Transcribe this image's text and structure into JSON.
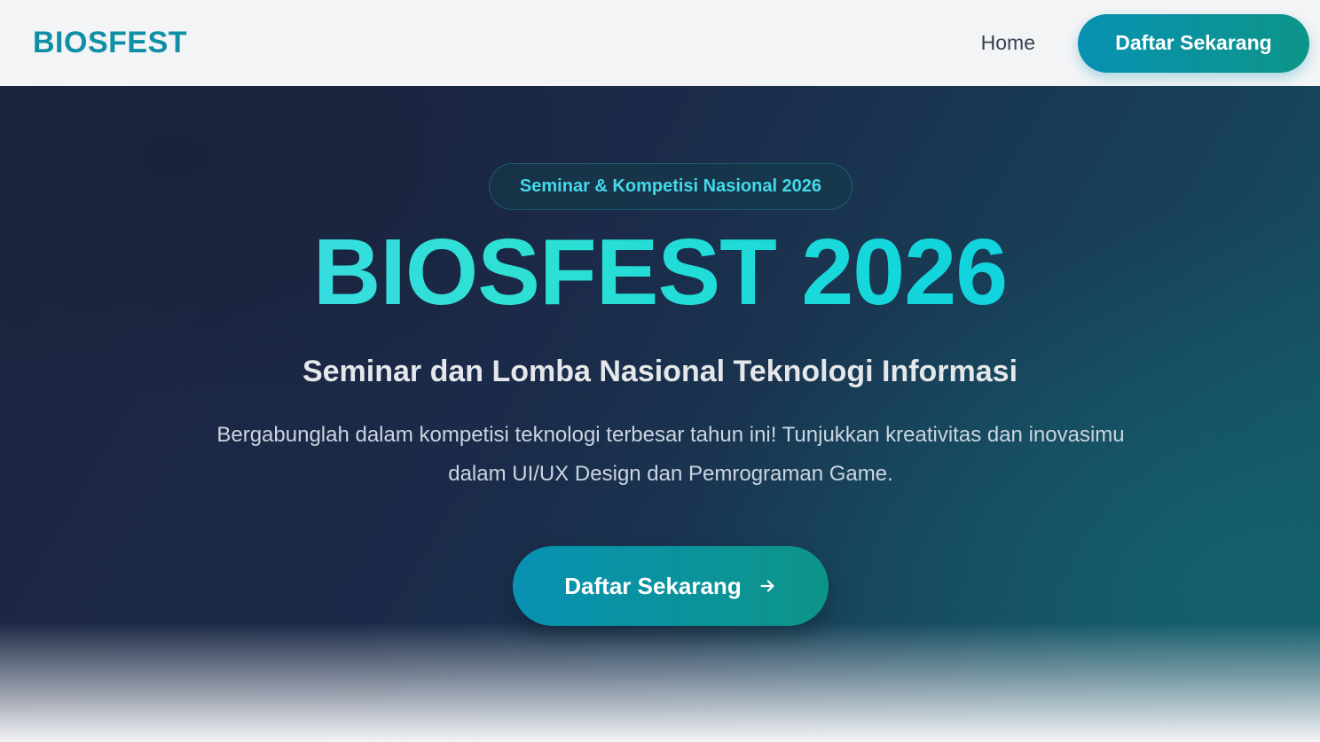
{
  "header": {
    "brand": "BIOSFEST",
    "nav_home": "Home",
    "cta_label": "Daftar Sekarang"
  },
  "hero": {
    "badge": "Seminar & Kompetisi Nasional 2026",
    "title": "BIOSFEST 2026",
    "subtitle": "Seminar dan Lomba Nasional Teknologi Informasi",
    "description": "Bergabunglah dalam kompetisi teknologi terbesar tahun ini! Tunjukkan kreativitas dan inovasimu dalam UI/UX Design dan Pemrograman Game.",
    "cta_label": "Daftar Sekarang",
    "cta_icon": "arrow-right-icon"
  },
  "colors": {
    "brand": "#0e8fa5",
    "accent_start": "#0891b2",
    "accent_end": "#0d9488",
    "title_gradient_start": "#44d8f0",
    "title_gradient_end": "#12c8e6"
  }
}
